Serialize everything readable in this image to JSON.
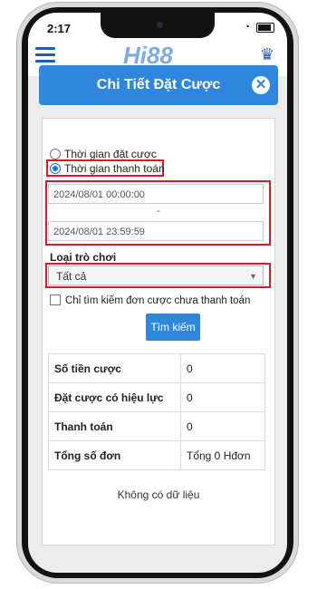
{
  "status_bar": {
    "time": "2:17"
  },
  "app_header": {
    "logo_text": "Hi88",
    "menu_icon": "hamburger-icon",
    "vip_icon": "crown-icon"
  },
  "modal": {
    "title": "Chi Tiết Đặt Cược",
    "close_icon": "close-icon"
  },
  "filters": {
    "time_options": [
      {
        "label": "Thời gian đặt cược",
        "checked": false
      },
      {
        "label": "Thời gian thanh toán",
        "checked": true
      }
    ],
    "date_from": "2024/08/01 00:00:00",
    "date_separator": "-",
    "date_to": "2024/08/01 23:59:59",
    "game_type_label": "Loại trò chơi",
    "game_type_selected": "Tất cả",
    "unsettled_only_label": "Chỉ tìm kiếm đơn cược chưa thanh toán",
    "unsettled_only_checked": false,
    "search_button": "Tìm kiếm"
  },
  "summary": [
    {
      "label": "Số tiền cược",
      "value": "0"
    },
    {
      "label": "Đặt cược có hiệu lực",
      "value": "0"
    },
    {
      "label": "Thanh toán",
      "value": "0"
    },
    {
      "label": "Tổng số đơn",
      "value": "Tổng 0 Hđơn"
    }
  ],
  "empty_message": "Không có dữ liệu",
  "colors": {
    "primary": "#2f86dd",
    "highlight": "#d91a2a"
  }
}
